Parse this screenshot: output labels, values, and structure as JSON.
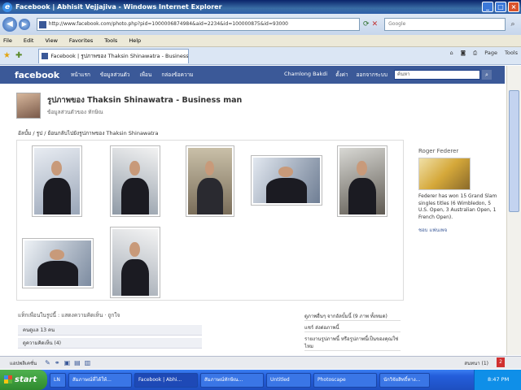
{
  "window": {
    "title": "Facebook | Abhisit Vejjajiva - Windows Internet Explorer"
  },
  "address_bar": {
    "url": "http://www.facebook.com/photo.php?pid=1000006874984&aid=2234&id=100000875&id=93000",
    "search_placeholder": "Google"
  },
  "menu": [
    "File",
    "Edit",
    "View",
    "Favorites",
    "Tools",
    "Help"
  ],
  "tab": {
    "label": "Facebook | รูปภาพของ Thaksin Shinawatra - Business man"
  },
  "tab_tools": [
    "Page",
    "Tools"
  ],
  "facebook": {
    "logo": "facebook",
    "nav_left": [
      "หน้าแรก",
      "ข้อมูลส่วนตัว",
      "เพื่อน",
      "กล่องข้อความ"
    ],
    "nav_right": [
      "Chamlong Bakdi",
      "ตั้งค่า",
      "ออกจากระบบ"
    ],
    "search_placeholder": "ค้นหา",
    "album_title": "รูปภาพของ Thaksin Shinawatra - Business man",
    "album_subtitle": "ข้อมูลส่วนตัวของ ทักษิณ",
    "breadcrumb": "อัลบั้ม / รูป / ย้อนกลับไปยังรูปภาพของ Thaksin Shinawatra",
    "sidebar": {
      "title": "Roger Federer",
      "text": "Federer has won 15 Grand Slam singles titles (6 Wimbledon, 5 U.S. Open, 3 Australian Open, 1 French Open).",
      "link": "ชอบ แฟนเพจ"
    },
    "bottom": {
      "label": "แท็กเพื่อนในรูปนี้ : แสดงความคิดเห็น · ถูกใจ",
      "rows": [
        "คนดูแล 13 คน",
        "ดูความคิดเห็น (4)"
      ]
    },
    "right_info": [
      "ดูภาพอื่นๆ จากอัลบั้มนี้ (9 ภาพ ทั้งหมด)",
      "แชร์ ส่งต่อภาพนี้",
      "รายงานรูปภาพนี้ หรือรูปภาพนี้เป็นของคุณใช่ไหม"
    ],
    "chatbar": {
      "left": "แอปพลิเคชั่น",
      "chat": "สนทนา (1)",
      "notifications": "2"
    }
  },
  "taskbar": {
    "start": "start",
    "items": [
      "LN",
      "สัมภาษณ์ที่ได้ให้...",
      "Facebook | Abhi...",
      "สัมภาษณ์ทักษิณ...",
      "Untitled",
      "Photoscape",
      "นักวิจัยสิทธิ์ทาง..."
    ],
    "tray_time": "8:47 PM"
  }
}
